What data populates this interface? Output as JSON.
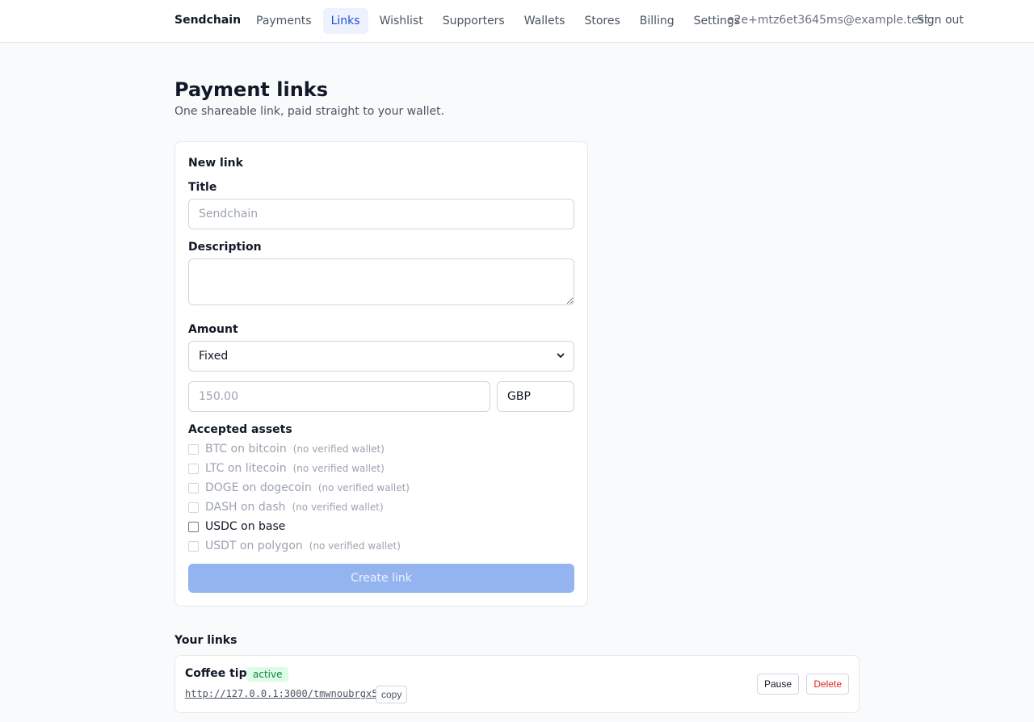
{
  "nav": {
    "brand": "Sendchain",
    "items": [
      {
        "label": "Payments",
        "active": false
      },
      {
        "label": "Links",
        "active": true
      },
      {
        "label": "Wishlist",
        "active": false
      },
      {
        "label": "Supporters",
        "active": false
      },
      {
        "label": "Wallets",
        "active": false
      },
      {
        "label": "Stores",
        "active": false
      },
      {
        "label": "Billing",
        "active": false
      },
      {
        "label": "Settings",
        "active": false
      }
    ],
    "email": "e2e+mtz6et3645ms@example.test",
    "sign_out": "Sign out"
  },
  "page": {
    "title": "Payment links",
    "subtitle": "One shareable link, paid straight to your wallet."
  },
  "form": {
    "heading": "New link",
    "title_label": "Title",
    "title_placeholder": "Sendchain",
    "description_label": "Description",
    "amount_label": "Amount",
    "amount_mode": "Fixed",
    "amount_placeholder": "150.00",
    "currency_value": "GBP",
    "assets_label": "Accepted assets",
    "assets": [
      {
        "name": "BTC on bitcoin",
        "note": "(no verified wallet)",
        "disabled": true
      },
      {
        "name": "LTC on litecoin",
        "note": "(no verified wallet)",
        "disabled": true
      },
      {
        "name": "DOGE on dogecoin",
        "note": "(no verified wallet)",
        "disabled": true
      },
      {
        "name": "DASH on dash",
        "note": "(no verified wallet)",
        "disabled": true
      },
      {
        "name": "USDC on base",
        "note": "",
        "disabled": false
      },
      {
        "name": "USDT on polygon",
        "note": "(no verified wallet)",
        "disabled": true
      }
    ],
    "submit_label": "Create link"
  },
  "links": {
    "heading": "Your links",
    "items": [
      {
        "title": "Coffee tip",
        "status": "active",
        "url": "http://127.0.0.1:3000/tmwnoubrgx5",
        "copy_label": "copy",
        "pause_label": "Pause",
        "delete_label": "Delete"
      }
    ]
  },
  "colors": {
    "accent": "#1d4ed8",
    "active_nav_bg": "#eef2ff",
    "button_disabled": "#93b4ef",
    "status_active": "#15803d",
    "danger": "#dc2626"
  }
}
